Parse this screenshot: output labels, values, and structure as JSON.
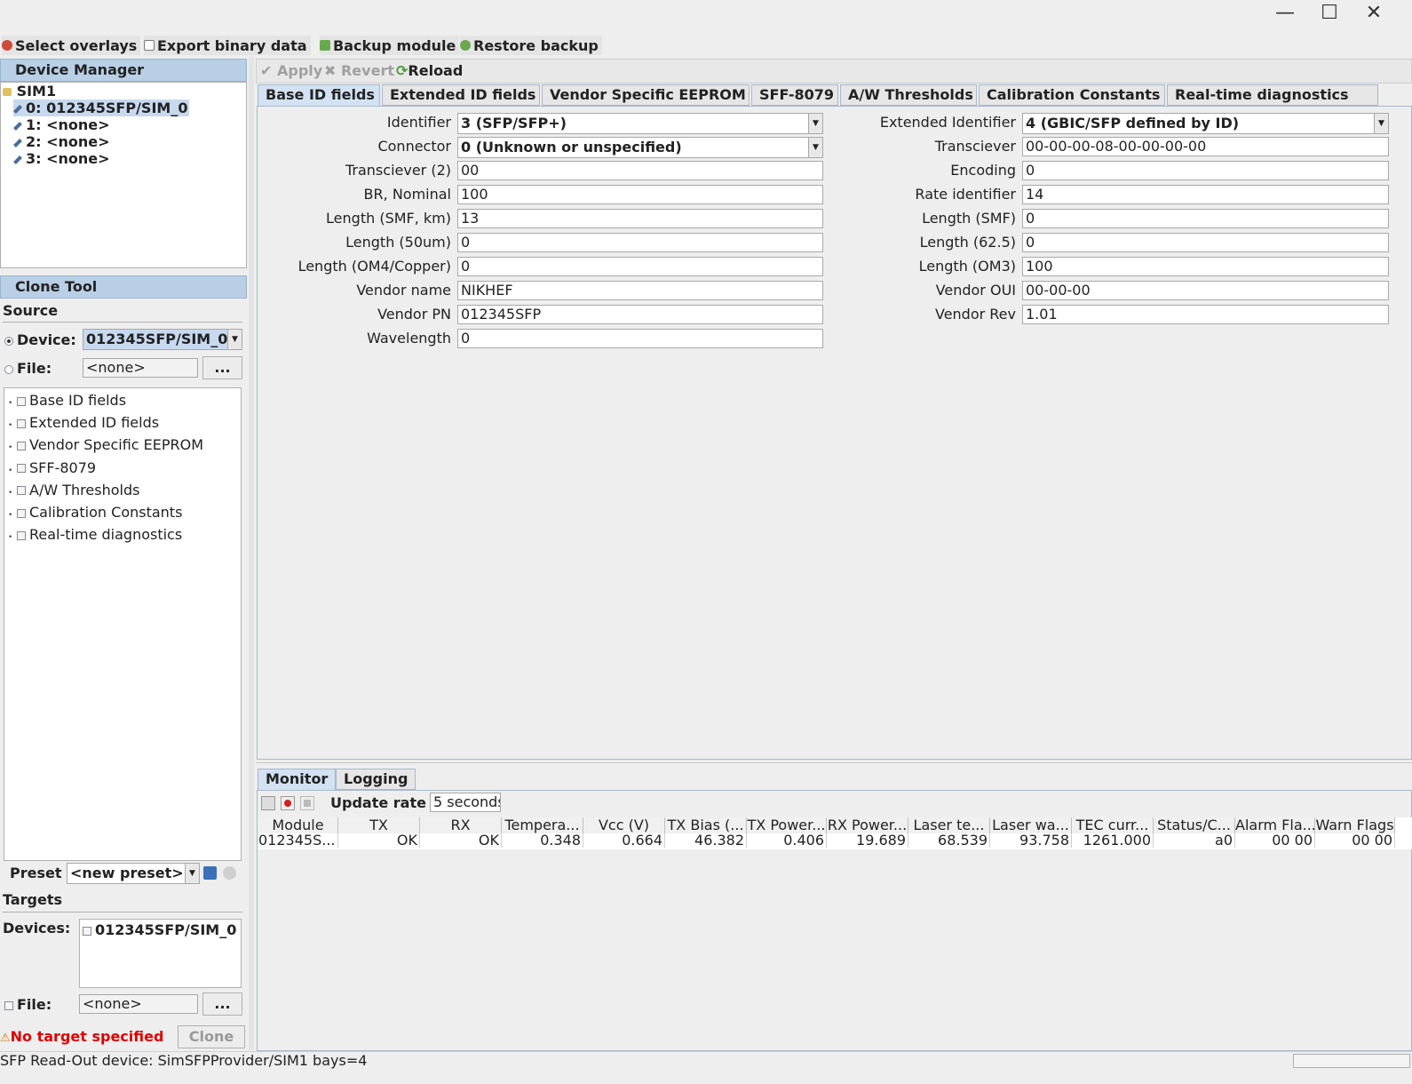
{
  "toolbar": {
    "select_overlays": "Select overlays",
    "export_binary": "Export binary data",
    "backup_module": "Backup module",
    "restore_backup": "Restore backup"
  },
  "device_manager": {
    "title": "Device Manager",
    "root": "SIM1",
    "items": [
      "0: 012345SFP/SIM_0",
      "1: <none>",
      "2: <none>",
      "3: <none>"
    ]
  },
  "clone_tool": {
    "title": "Clone Tool",
    "source_label": "Source",
    "device_label": "Device:",
    "device_value": "012345SFP/SIM_0",
    "file_label": "File:",
    "file_value": "<none>",
    "browse": "...",
    "tree_items": [
      "Base ID fields",
      "Extended ID fields",
      "Vendor Specific EEPROM",
      "SFF-8079",
      "A/W Thresholds",
      "Calibration Constants",
      "Real-time diagnostics"
    ],
    "preset_label": "Preset",
    "preset_value": "<new preset>",
    "targets_label": "Targets",
    "devices_label": "Devices:",
    "target_device": "012345SFP/SIM_0",
    "target_file_label": "File:",
    "target_file_value": "<none>",
    "target_browse": "...",
    "warning": "No target specified",
    "clone_button": "Clone"
  },
  "editor_toolbar": {
    "apply": "Apply",
    "revert": "Revert",
    "reload": "Reload"
  },
  "tabs": [
    "Base ID fields",
    "Extended ID fields",
    "Vendor Specific EEPROM",
    "SFF-8079",
    "A/W Thresholds",
    "Calibration Constants",
    "Real-time diagnostics"
  ],
  "left_fields": [
    {
      "label": "Identifier",
      "value": "3 (SFP/SFP+)",
      "combo": true
    },
    {
      "label": "Connector",
      "value": "0 (Unknown or unspecified)",
      "combo": true
    },
    {
      "label": "Transciever (2)",
      "value": "00"
    },
    {
      "label": "BR, Nominal",
      "value": "100"
    },
    {
      "label": "Length (SMF, km)",
      "value": "13"
    },
    {
      "label": "Length (50um)",
      "value": "0"
    },
    {
      "label": "Length (OM4/Copper)",
      "value": "0"
    },
    {
      "label": "Vendor name",
      "value": "NIKHEF"
    },
    {
      "label": "Vendor PN",
      "value": "012345SFP"
    },
    {
      "label": "Wavelength",
      "value": "0"
    }
  ],
  "right_fields": [
    {
      "label": "Extended Identifier",
      "value": "4 (GBIC/SFP defined by ID)",
      "combo": true
    },
    {
      "label": "Transciever",
      "value": "00-00-00-08-00-00-00-00"
    },
    {
      "label": "Encoding",
      "value": "0"
    },
    {
      "label": "Rate identifier",
      "value": "14"
    },
    {
      "label": "Length (SMF)",
      "value": "0"
    },
    {
      "label": "Length (62.5)",
      "value": "0"
    },
    {
      "label": "Length (OM3)",
      "value": "100"
    },
    {
      "label": "Vendor OUI",
      "value": "00-00-00"
    },
    {
      "label": "Vendor Rev",
      "value": "1.01"
    }
  ],
  "monitor": {
    "tabs": [
      "Monitor",
      "Logging"
    ],
    "update_rate_label": "Update rate",
    "update_rate_value": "5 seconds",
    "columns": [
      "Module",
      "TX",
      "RX",
      "Tempera...",
      "Vcc (V)",
      "TX Bias (...",
      "TX Power...",
      "RX Power...",
      "Laser te...",
      "Laser wa...",
      "TEC curr...",
      "Status/C...",
      "Alarm Fla...",
      "Warn Flags"
    ],
    "row": [
      "012345S...",
      "OK",
      "OK",
      "0.348",
      "0.664",
      "46.382",
      "0.406",
      "19.689",
      "68.539",
      "93.758",
      "1261.000",
      "a0",
      "00 00",
      "00 00"
    ]
  },
  "status_bar": "SFP Read-Out device: SimSFPProvider/SIM1 bays=4",
  "colors": {
    "panel_header": "#b8cfe5",
    "selection": "#c7d9ee",
    "warning": "#e00000"
  }
}
